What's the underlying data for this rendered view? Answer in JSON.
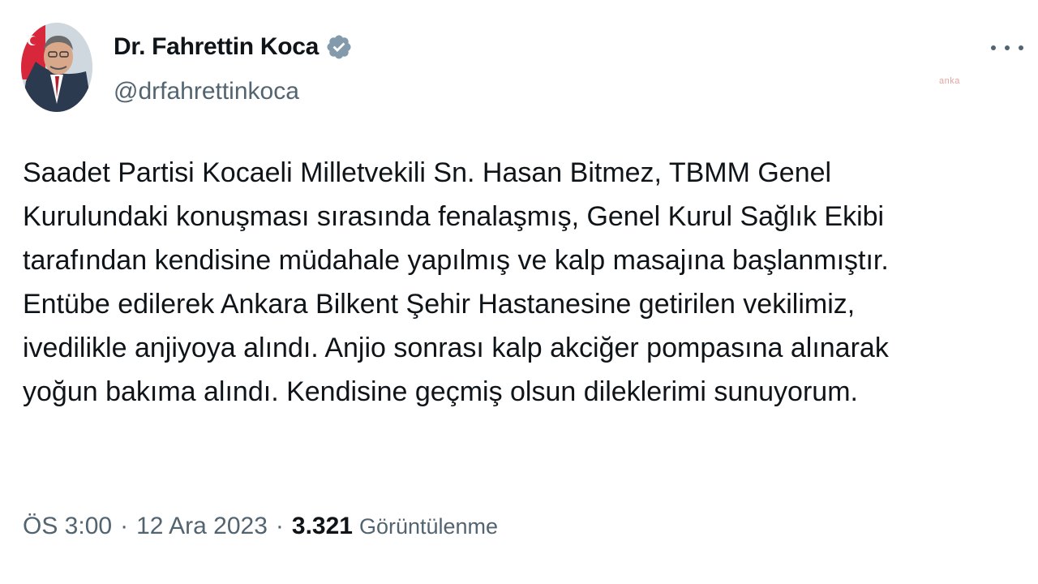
{
  "author": {
    "display_name": "Dr. Fahrettin Koca",
    "handle": "@drfahrettinkoca",
    "verified": true
  },
  "tweet": {
    "lines": [
      "Saadet Partisi Kocaeli Milletvekili Sn. Hasan Bitmez, TBMM Genel",
      "Kurulundaki konuşması sırasında fenalaşmış, Genel Kurul Sağlık Ekibi",
      "tarafından kendisine müdahale yapılmış ve kalp masajına başlanmıştır.",
      "Entübe edilerek Ankara Bilkent Şehir Hastanesine getirilen vekilimiz,",
      "ivedilikle anjiyoya alındı. Anjio sonrası kalp akciğer pompasına alınarak",
      "yoğun bakıma alındı. Kendisine geçmiş olsun dileklerimi sunuyorum."
    ]
  },
  "meta": {
    "time": "ÖS 3:00",
    "separator": "·",
    "date": "12 Ara 2023",
    "views_count": "3.321",
    "views_label": "Görüntülenme"
  },
  "watermark": "anka",
  "colors": {
    "text": "#0f1419",
    "secondary": "#536471",
    "verified": "#829aab"
  },
  "icons": {
    "verified": "verified-badge-icon",
    "more": "more-dots-icon"
  }
}
